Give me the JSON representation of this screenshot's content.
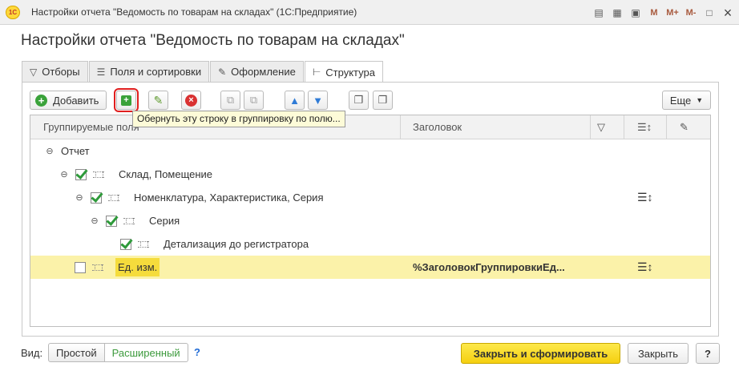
{
  "window": {
    "title": "Настройки отчета \"Ведомость по товарам на складах\"  (1С:Предприятие)",
    "logo_text": "1С",
    "controls": [
      "М",
      "М+",
      "М-"
    ]
  },
  "page_title": "Настройки отчета \"Ведомость по товарам на складах\"",
  "tabs": [
    {
      "label": "Отборы",
      "icon": "filter-icon",
      "active": false
    },
    {
      "label": "Поля и сортировки",
      "icon": "sort-fields-icon",
      "active": false
    },
    {
      "label": "Оформление",
      "icon": "brush-icon",
      "active": false
    },
    {
      "label": "Структура",
      "icon": "structure-icon",
      "active": true
    }
  ],
  "toolbar": {
    "add_label": "Добавить",
    "more_label": "Еще",
    "tooltip": "Обернуть эту строку в группировку по полю..."
  },
  "grid": {
    "columns": {
      "fields": "Группируемые поля",
      "heading": "Заголовок"
    },
    "rows": [
      {
        "label": "Отчет",
        "level": 0,
        "checkbox": false,
        "checked": false,
        "expander": "⊖",
        "heading": "",
        "sort_icon": false,
        "selected": false
      },
      {
        "label": "Склад, Помещение",
        "level": 1,
        "checkbox": true,
        "checked": true,
        "expander": "⊖",
        "heading": "",
        "sort_icon": false,
        "selected": false
      },
      {
        "label": "Номенклатура, Характеристика, Серия",
        "level": 2,
        "checkbox": true,
        "checked": true,
        "expander": "⊖",
        "heading": "",
        "sort_icon": true,
        "selected": false
      },
      {
        "label": "Серия",
        "level": 3,
        "checkbox": true,
        "checked": true,
        "expander": "⊖",
        "heading": "",
        "sort_icon": false,
        "selected": false
      },
      {
        "label": "Детализация до регистратора",
        "level": 4,
        "checkbox": true,
        "checked": true,
        "expander": "",
        "heading": "",
        "sort_icon": false,
        "selected": false
      },
      {
        "label": "Ед. изм.",
        "level": 1,
        "checkbox": true,
        "checked": false,
        "expander": "",
        "heading": "%ЗаголовокГруппировкиЕд...",
        "sort_icon": true,
        "selected": true
      }
    ]
  },
  "footer": {
    "view_label": "Вид:",
    "simple_label": "Простой",
    "extended_label": "Расширенный",
    "help_link": "?",
    "primary_label": "Закрыть и сформировать",
    "close_label": "Закрыть",
    "help_label": "?"
  }
}
